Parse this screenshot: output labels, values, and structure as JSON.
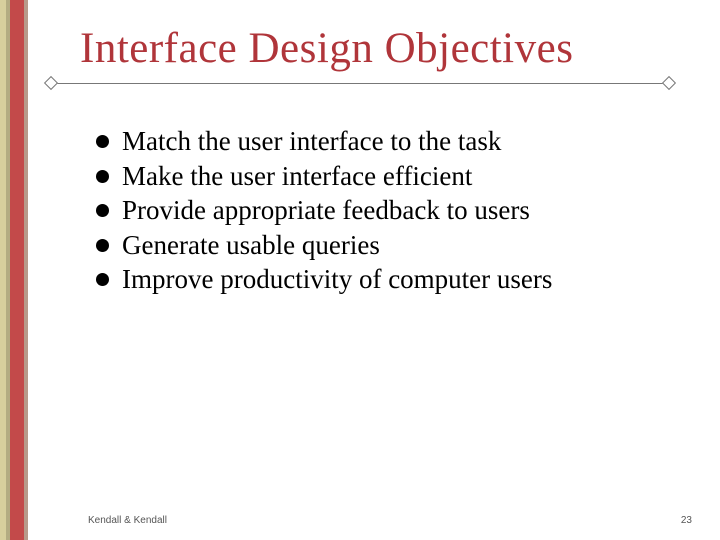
{
  "title": "Interface Design Objectives",
  "bullets": [
    "Match the user interface to the task",
    "Make the user interface efficient",
    "Provide appropriate feedback to users",
    "Generate usable queries",
    "Improve productivity of computer users"
  ],
  "footer": {
    "left": "Kendall & Kendall",
    "right": "23"
  }
}
